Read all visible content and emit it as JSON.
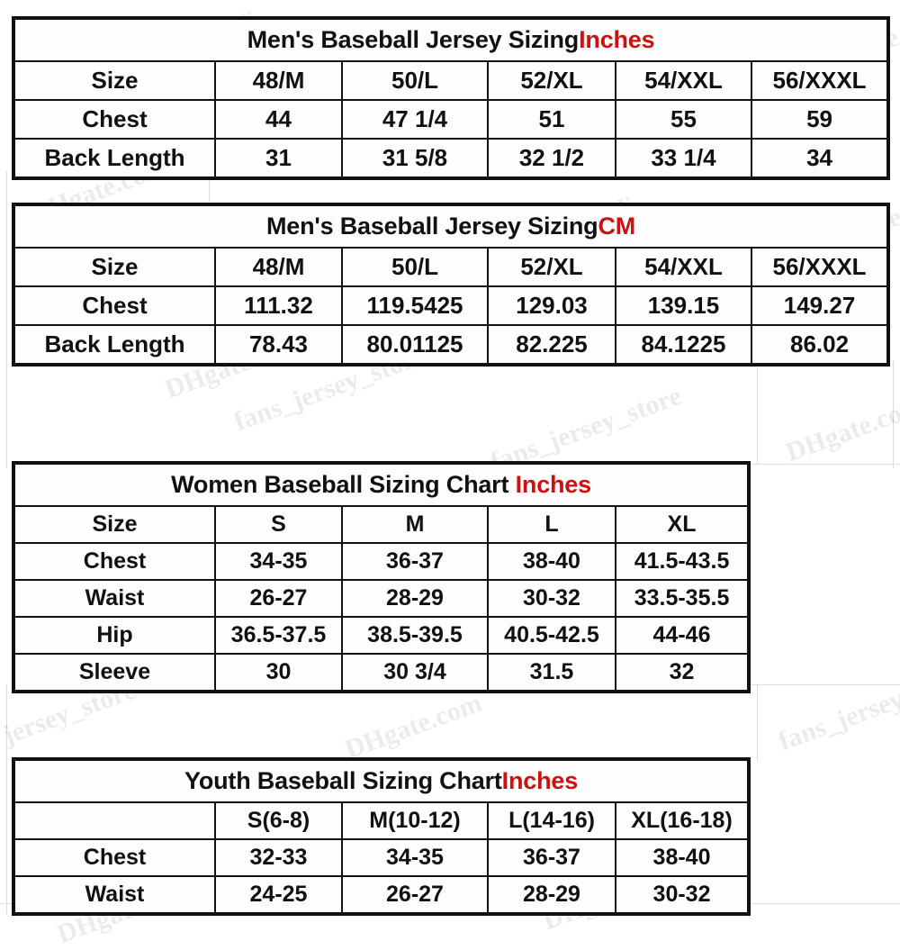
{
  "background": {
    "page_color": "#ffffff",
    "grid_color": "#dcdcdc",
    "accent_red": "#cc1111",
    "accent_teal": "#16706c",
    "border_color": "#111111"
  },
  "watermarks": [
    "DHgate.com",
    "fans_jersey_store"
  ],
  "tables": [
    {
      "id": "men-inches",
      "title": "Men's Baseball Jersey Sizing",
      "unit": "Inches",
      "header_label": "Size",
      "columns": [
        "48/M",
        "50/L",
        "52/XL",
        "54/XXL",
        "56/XXXL"
      ],
      "rows": [
        {
          "label": "Chest",
          "values": [
            "44",
            "47 1/4",
            "51",
            "55",
            "59"
          ]
        },
        {
          "label": "Back Length",
          "values": [
            "31",
            "31 5/8",
            "32 1/2",
            "33 1/4",
            "34"
          ]
        }
      ]
    },
    {
      "id": "men-cm",
      "title": "Men's Baseball Jersey Sizing",
      "unit": "CM",
      "header_label": "Size",
      "columns": [
        "48/M",
        "50/L",
        "52/XL",
        "54/XXL",
        "56/XXXL"
      ],
      "rows": [
        {
          "label": "Chest",
          "values": [
            "111.32",
            "119.5425",
            "129.03",
            "139.15",
            "149.27"
          ]
        },
        {
          "label": "Back Length",
          "values": [
            "78.43",
            "80.01125",
            "82.225",
            "84.1225",
            "86.02"
          ]
        }
      ]
    },
    {
      "id": "women",
      "title": "Women Baseball Sizing Chart ",
      "unit": "Inches",
      "header_label": "Size",
      "columns": [
        "S",
        "M",
        "L",
        "XL"
      ],
      "rows": [
        {
          "label": "Chest",
          "values": [
            "34-35",
            "36-37",
            "38-40",
            "41.5-43.5"
          ]
        },
        {
          "label": "Waist",
          "values": [
            "26-27",
            "28-29",
            "30-32",
            "33.5-35.5"
          ]
        },
        {
          "label": "Hip",
          "values": [
            "36.5-37.5",
            "38.5-39.5",
            "40.5-42.5",
            "44-46"
          ]
        },
        {
          "label": "Sleeve",
          "values": [
            "30",
            "30 3/4",
            "31.5",
            "32"
          ]
        }
      ]
    },
    {
      "id": "youth",
      "title": "Youth Baseball Sizing Chart",
      "unit": "Inches",
      "header_label": "",
      "columns": [
        "S(6-8)",
        "M(10-12)",
        "L(14-16)",
        "XL(16-18)"
      ],
      "rows": [
        {
          "label": "Chest",
          "values": [
            "32-33",
            "34-35",
            "36-37",
            "38-40"
          ]
        },
        {
          "label": "Waist",
          "values": [
            "24-25",
            "26-27",
            "28-29",
            "30-32"
          ]
        }
      ]
    }
  ]
}
